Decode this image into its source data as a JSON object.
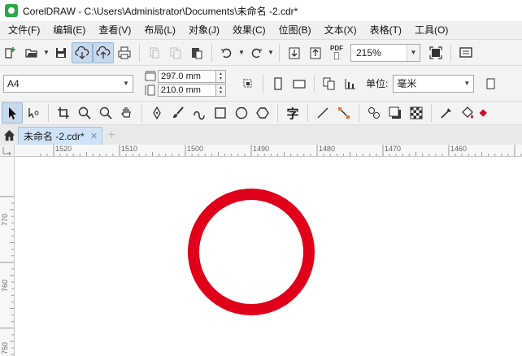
{
  "window": {
    "title": "CorelDRAW - C:\\Users\\Administrator\\Documents\\未命名 -2.cdr*"
  },
  "menu": {
    "items": [
      "文件(F)",
      "编辑(E)",
      "查看(V)",
      "布局(L)",
      "对象(J)",
      "效果(C)",
      "位图(B)",
      "文本(X)",
      "表格(T)",
      "工具(O)"
    ]
  },
  "standard_toolbar": {
    "pdf_label": "PDF",
    "zoom_value": "215%"
  },
  "property_bar": {
    "page_size": "A4",
    "width_value": "297.0 mm",
    "height_value": "210.0 mm",
    "units_label": "单位:",
    "units_value": "毫米"
  },
  "toolbox": {
    "text_tool_glyph": "字"
  },
  "document_tabs": {
    "active": "未命名 -2.cdr*"
  },
  "rulers": {
    "horizontal": [
      "1520",
      "1510",
      "1500",
      "1490",
      "1480",
      "1470",
      "1460"
    ],
    "vertical": [
      "770",
      "760",
      "750"
    ]
  },
  "canvas": {
    "circle_stroke_color": "#e0001a"
  }
}
